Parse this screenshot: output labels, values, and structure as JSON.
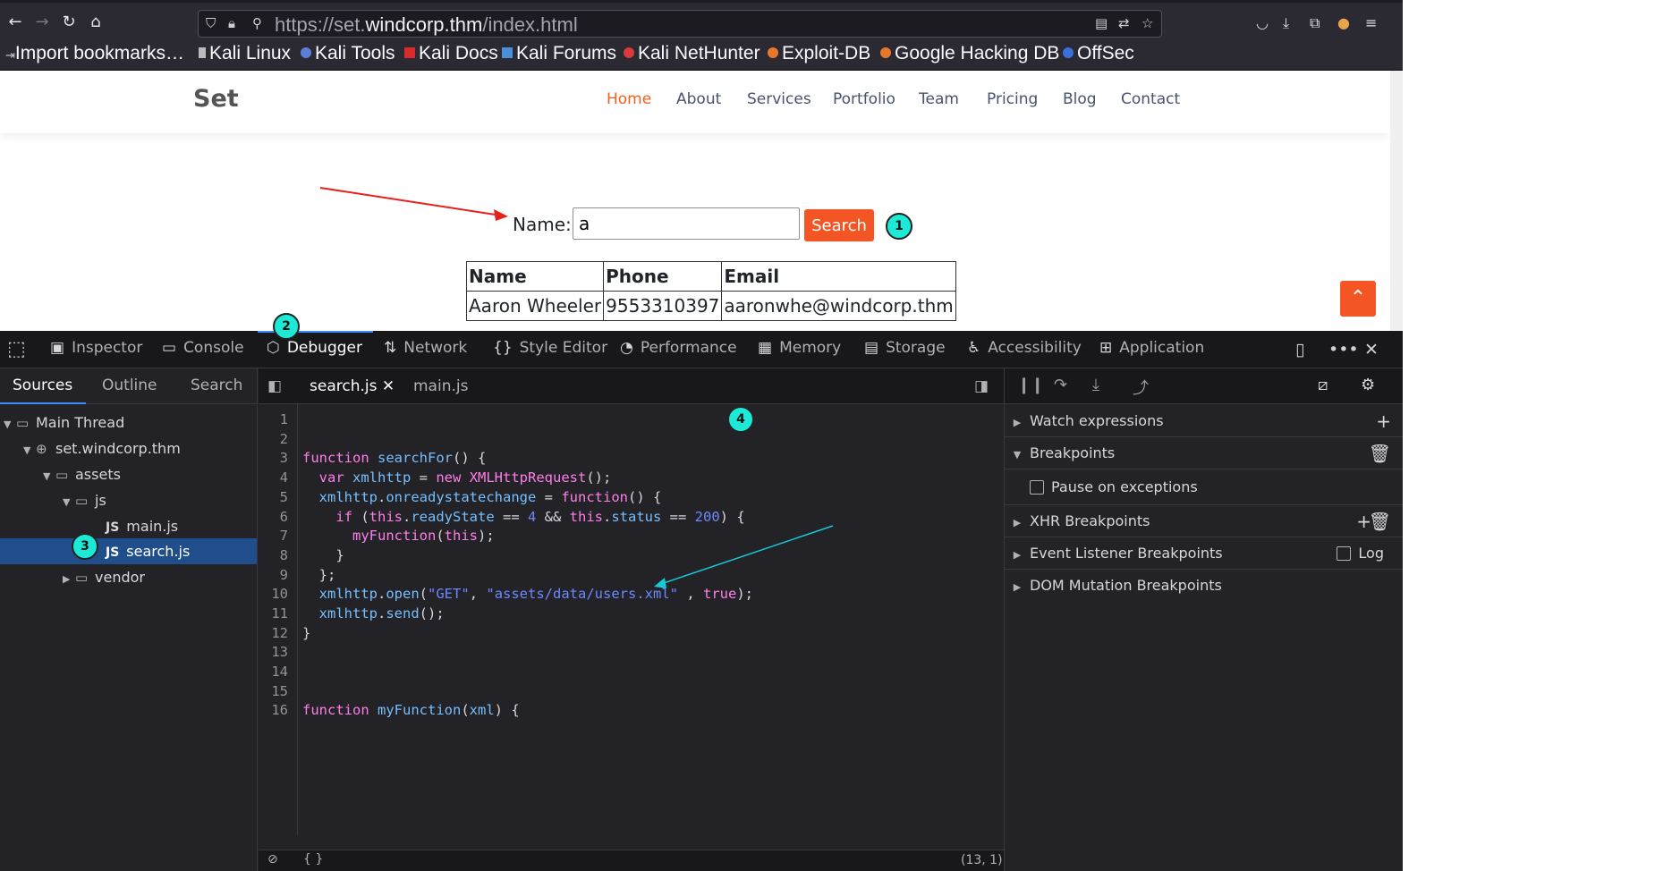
{
  "browser": {
    "url_scheme": "https://set.",
    "url_host": "windcorp.thm",
    "url_path": "/index.html",
    "bookmarks": [
      "Import bookmarks…",
      "Kali Linux",
      "Kali Tools",
      "Kali Docs",
      "Kali Forums",
      "Kali NetHunter",
      "Exploit-DB",
      "Google Hacking DB",
      "OffSec"
    ]
  },
  "site": {
    "logo": "Set",
    "menu": [
      "Home",
      "About",
      "Services",
      "Portfolio",
      "Team",
      "Pricing",
      "Blog",
      "Contact"
    ],
    "search_label": "Name:",
    "search_value": "a",
    "search_button": "Search",
    "table_headers": [
      "Name",
      "Phone",
      "Email"
    ],
    "table_rows": [
      [
        "Aaron Wheeler",
        "9553310397",
        "aaronwhe@windcorp.thm"
      ]
    ],
    "back_to_top": "⌃",
    "accent_color": "#f35525"
  },
  "annotations": {
    "b1": "1",
    "b2": "2",
    "b3": "3",
    "b4": "4"
  },
  "devtools": {
    "tabs": [
      "Inspector",
      "Console",
      "Debugger",
      "Network",
      "Style Editor",
      "Performance",
      "Memory",
      "Storage",
      "Accessibility",
      "Application"
    ],
    "source_tabs": [
      "Sources",
      "Outline",
      "Search"
    ],
    "tree": [
      "Main Thread",
      "set.windcorp.thm",
      "assets",
      "js",
      "main.js",
      "search.js",
      "vendor"
    ],
    "js_label": "JS",
    "editor_tabs": [
      "search.js",
      "main.js"
    ],
    "cursor_pos": "(13, 1)",
    "pretty_print": "{ }",
    "right_sections": [
      "Watch expressions",
      "Breakpoints",
      "Pause on exceptions",
      "XHR Breakpoints",
      "Event Listener Breakpoints",
      "DOM Mutation Breakpoints"
    ],
    "log_label": "Log"
  }
}
